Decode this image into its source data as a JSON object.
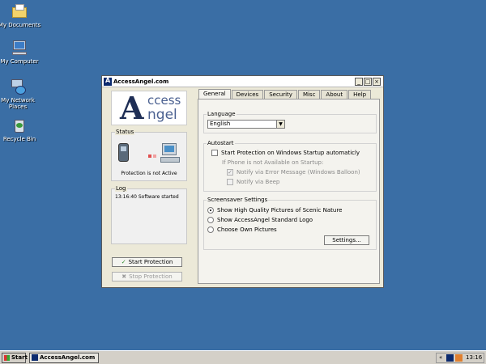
{
  "desktop": {
    "icons": [
      {
        "label": "My Documents",
        "icon": "folder-icon"
      },
      {
        "label": "My Computer",
        "icon": "computer-icon"
      },
      {
        "label": "My Network Places",
        "icon": "network-icon"
      },
      {
        "label": "Recycle Bin",
        "icon": "recycle-bin-icon"
      }
    ]
  },
  "window": {
    "title": "AccessAngel.com",
    "logo_top": "ccess",
    "logo_bottom": "ngel",
    "logo_letter": "A",
    "status_label": "Status",
    "status_text": "Protection is not Active",
    "log_label": "Log",
    "log_text": "13:16:40 Software started",
    "start_btn": "Start Protection",
    "stop_btn": "Stop Protection",
    "tabs": [
      "General",
      "Devices",
      "Security",
      "Misc",
      "About",
      "Help"
    ],
    "general": {
      "language_label": "Language",
      "language_value": "English",
      "autostart_label": "Autostart",
      "autostart_option": "Start Protection on Windows Startup automaticly",
      "not_available_text": "If Phone is not Available on Startup:",
      "notify_error": "Notify via Error Message (Windows Balloon)",
      "notify_beep": "Notify via Beep",
      "screensaver_label": "Screensaver Settings",
      "ss_option1": "Show High Quality Pictures of Scenic Nature",
      "ss_option2": "Show AccessAngel Standard Logo",
      "ss_option3": "Choose Own Pictures",
      "settings_btn": "Settings..."
    }
  },
  "taskbar": {
    "start": "Start",
    "task_item": "AccessAngel.com",
    "chevron": "«",
    "clock": "13:16"
  },
  "colors": {
    "desktop": "#3a6ea5",
    "dot_red": "#e05050",
    "dot_pink": "#f0a0a0"
  }
}
